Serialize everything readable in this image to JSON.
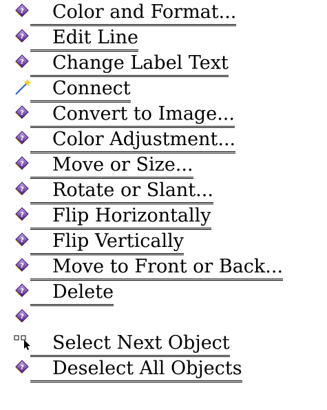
{
  "menu": {
    "items": [
      {
        "label": "Color and Format...",
        "icon": "help-diamond-icon"
      },
      {
        "label": "Edit Line",
        "icon": "help-diamond-icon"
      },
      {
        "label": "Change Label Text",
        "icon": "help-diamond-icon"
      },
      {
        "label": "Connect",
        "icon": "connect-wand-icon"
      },
      {
        "label": "Convert to Image...",
        "icon": "help-diamond-icon"
      },
      {
        "label": "Color Adjustment...",
        "icon": "help-diamond-icon"
      },
      {
        "label": "Move or Size...",
        "icon": "help-diamond-icon"
      },
      {
        "label": "Rotate or Slant...",
        "icon": "help-diamond-icon"
      },
      {
        "label": "Flip Horizontally",
        "icon": "help-diamond-icon"
      },
      {
        "label": "Flip Vertically",
        "icon": "help-diamond-icon"
      },
      {
        "label": "Move to Front or Back...",
        "icon": "help-diamond-icon"
      },
      {
        "label": "Delete",
        "icon": "help-diamond-icon"
      },
      {
        "label": "",
        "icon": "help-diamond-icon"
      },
      {
        "label": "Select Next Object",
        "icon": "select-next-object-icon"
      },
      {
        "label": "Deselect All Objects",
        "icon": "help-diamond-icon"
      }
    ]
  },
  "colors": {
    "diamond_top": "#b89bd8",
    "diamond_bottom": "#5a2a8a",
    "diamond_shadow": "#e7d53a",
    "link": "#000000"
  }
}
